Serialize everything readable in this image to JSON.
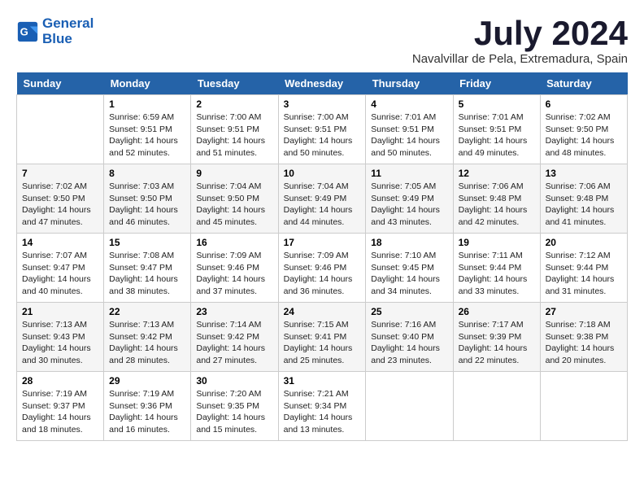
{
  "header": {
    "logo_line1": "General",
    "logo_line2": "Blue",
    "month_title": "July 2024",
    "location": "Navalvillar de Pela, Extremadura, Spain"
  },
  "days_of_week": [
    "Sunday",
    "Monday",
    "Tuesday",
    "Wednesday",
    "Thursday",
    "Friday",
    "Saturday"
  ],
  "weeks": [
    [
      {
        "day": "",
        "info": ""
      },
      {
        "day": "1",
        "info": "Sunrise: 6:59 AM\nSunset: 9:51 PM\nDaylight: 14 hours\nand 52 minutes."
      },
      {
        "day": "2",
        "info": "Sunrise: 7:00 AM\nSunset: 9:51 PM\nDaylight: 14 hours\nand 51 minutes."
      },
      {
        "day": "3",
        "info": "Sunrise: 7:00 AM\nSunset: 9:51 PM\nDaylight: 14 hours\nand 50 minutes."
      },
      {
        "day": "4",
        "info": "Sunrise: 7:01 AM\nSunset: 9:51 PM\nDaylight: 14 hours\nand 50 minutes."
      },
      {
        "day": "5",
        "info": "Sunrise: 7:01 AM\nSunset: 9:51 PM\nDaylight: 14 hours\nand 49 minutes."
      },
      {
        "day": "6",
        "info": "Sunrise: 7:02 AM\nSunset: 9:50 PM\nDaylight: 14 hours\nand 48 minutes."
      }
    ],
    [
      {
        "day": "7",
        "info": "Sunrise: 7:02 AM\nSunset: 9:50 PM\nDaylight: 14 hours\nand 47 minutes."
      },
      {
        "day": "8",
        "info": "Sunrise: 7:03 AM\nSunset: 9:50 PM\nDaylight: 14 hours\nand 46 minutes."
      },
      {
        "day": "9",
        "info": "Sunrise: 7:04 AM\nSunset: 9:50 PM\nDaylight: 14 hours\nand 45 minutes."
      },
      {
        "day": "10",
        "info": "Sunrise: 7:04 AM\nSunset: 9:49 PM\nDaylight: 14 hours\nand 44 minutes."
      },
      {
        "day": "11",
        "info": "Sunrise: 7:05 AM\nSunset: 9:49 PM\nDaylight: 14 hours\nand 43 minutes."
      },
      {
        "day": "12",
        "info": "Sunrise: 7:06 AM\nSunset: 9:48 PM\nDaylight: 14 hours\nand 42 minutes."
      },
      {
        "day": "13",
        "info": "Sunrise: 7:06 AM\nSunset: 9:48 PM\nDaylight: 14 hours\nand 41 minutes."
      }
    ],
    [
      {
        "day": "14",
        "info": "Sunrise: 7:07 AM\nSunset: 9:47 PM\nDaylight: 14 hours\nand 40 minutes."
      },
      {
        "day": "15",
        "info": "Sunrise: 7:08 AM\nSunset: 9:47 PM\nDaylight: 14 hours\nand 38 minutes."
      },
      {
        "day": "16",
        "info": "Sunrise: 7:09 AM\nSunset: 9:46 PM\nDaylight: 14 hours\nand 37 minutes."
      },
      {
        "day": "17",
        "info": "Sunrise: 7:09 AM\nSunset: 9:46 PM\nDaylight: 14 hours\nand 36 minutes."
      },
      {
        "day": "18",
        "info": "Sunrise: 7:10 AM\nSunset: 9:45 PM\nDaylight: 14 hours\nand 34 minutes."
      },
      {
        "day": "19",
        "info": "Sunrise: 7:11 AM\nSunset: 9:44 PM\nDaylight: 14 hours\nand 33 minutes."
      },
      {
        "day": "20",
        "info": "Sunrise: 7:12 AM\nSunset: 9:44 PM\nDaylight: 14 hours\nand 31 minutes."
      }
    ],
    [
      {
        "day": "21",
        "info": "Sunrise: 7:13 AM\nSunset: 9:43 PM\nDaylight: 14 hours\nand 30 minutes."
      },
      {
        "day": "22",
        "info": "Sunrise: 7:13 AM\nSunset: 9:42 PM\nDaylight: 14 hours\nand 28 minutes."
      },
      {
        "day": "23",
        "info": "Sunrise: 7:14 AM\nSunset: 9:42 PM\nDaylight: 14 hours\nand 27 minutes."
      },
      {
        "day": "24",
        "info": "Sunrise: 7:15 AM\nSunset: 9:41 PM\nDaylight: 14 hours\nand 25 minutes."
      },
      {
        "day": "25",
        "info": "Sunrise: 7:16 AM\nSunset: 9:40 PM\nDaylight: 14 hours\nand 23 minutes."
      },
      {
        "day": "26",
        "info": "Sunrise: 7:17 AM\nSunset: 9:39 PM\nDaylight: 14 hours\nand 22 minutes."
      },
      {
        "day": "27",
        "info": "Sunrise: 7:18 AM\nSunset: 9:38 PM\nDaylight: 14 hours\nand 20 minutes."
      }
    ],
    [
      {
        "day": "28",
        "info": "Sunrise: 7:19 AM\nSunset: 9:37 PM\nDaylight: 14 hours\nand 18 minutes."
      },
      {
        "day": "29",
        "info": "Sunrise: 7:19 AM\nSunset: 9:36 PM\nDaylight: 14 hours\nand 16 minutes."
      },
      {
        "day": "30",
        "info": "Sunrise: 7:20 AM\nSunset: 9:35 PM\nDaylight: 14 hours\nand 15 minutes."
      },
      {
        "day": "31",
        "info": "Sunrise: 7:21 AM\nSunset: 9:34 PM\nDaylight: 14 hours\nand 13 minutes."
      },
      {
        "day": "",
        "info": ""
      },
      {
        "day": "",
        "info": ""
      },
      {
        "day": "",
        "info": ""
      }
    ]
  ]
}
